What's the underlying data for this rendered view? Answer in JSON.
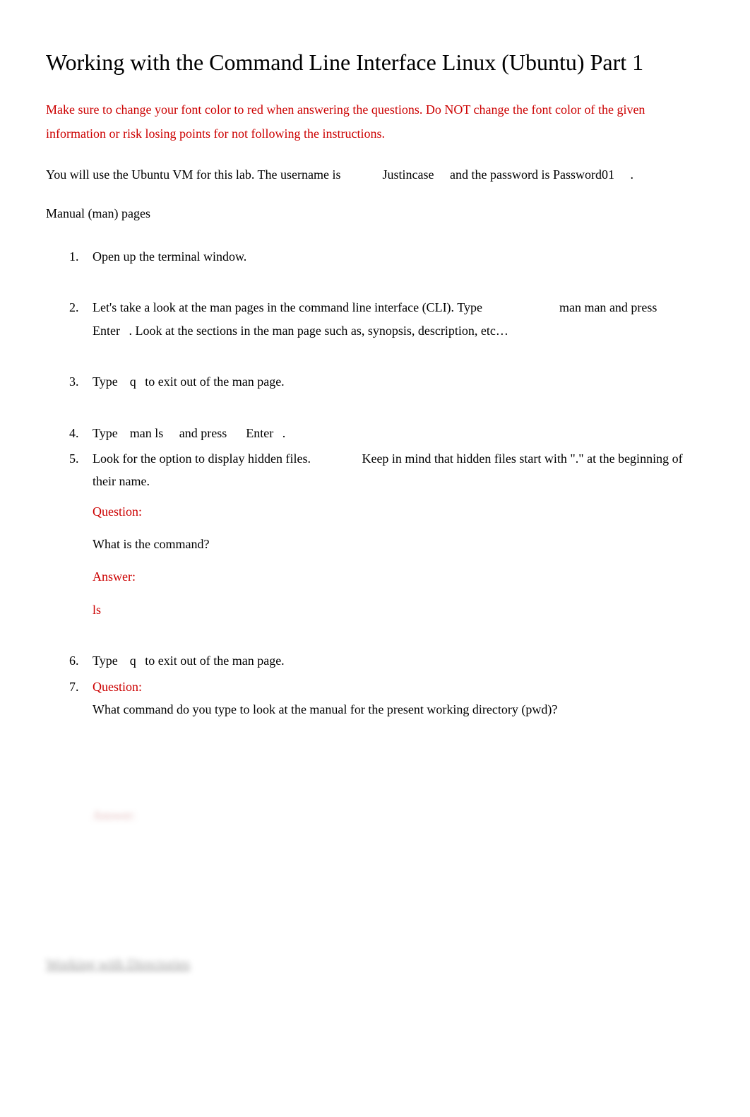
{
  "title": "Working with the Command Line Interface Linux (Ubuntu) Part 1",
  "warning": "Make sure to change your font color to red when answering the questions. Do NOT change the font color of the given information or risk losing points for not following the instructions.",
  "intro": {
    "p1": "You will use the Ubuntu VM for this lab. The username is ",
    "user": "Justincase",
    "p2": " and the password is ",
    "pass": "Password01",
    "p3": "."
  },
  "section1": "Manual (man) pages",
  "steps": {
    "s1": "Open up the terminal window.",
    "s2_a": "Let's take a look at the man pages in the command line interface (CLI). Type ",
    "s2_cmd": "man man",
    "s2_b": " and press ",
    "s2_key": "Enter",
    "s2_c": ".  Look at the sections in the man page such as, synopsis, description, etc…",
    "s3_a": "Type ",
    "s3_key": "q",
    "s3_b": " to exit out of the man page.",
    "s4_a": "Type ",
    "s4_cmd": "man ls",
    "s4_b": " and press ",
    "s4_key": "Enter",
    "s4_c": ".",
    "s5_a": "Look for the option to display hidden files.",
    "s5_b": "Keep in mind that hidden files start with \".\" at the beginning of their name.",
    "q5_q_label": "Question:",
    "q5_q": "What is the command?",
    "q5_a_label": "Answer:",
    "q5_a": "ls",
    "s6_a": "Type ",
    "s6_key": "q",
    "s6_b": " to exit out of the man page.",
    "q7_label": "Question:",
    "q7_q": "What command do you type to look at the manual for the present working directory (pwd)?"
  },
  "blurred_answer": "Answer:",
  "blurred_section": "Working with Directories"
}
